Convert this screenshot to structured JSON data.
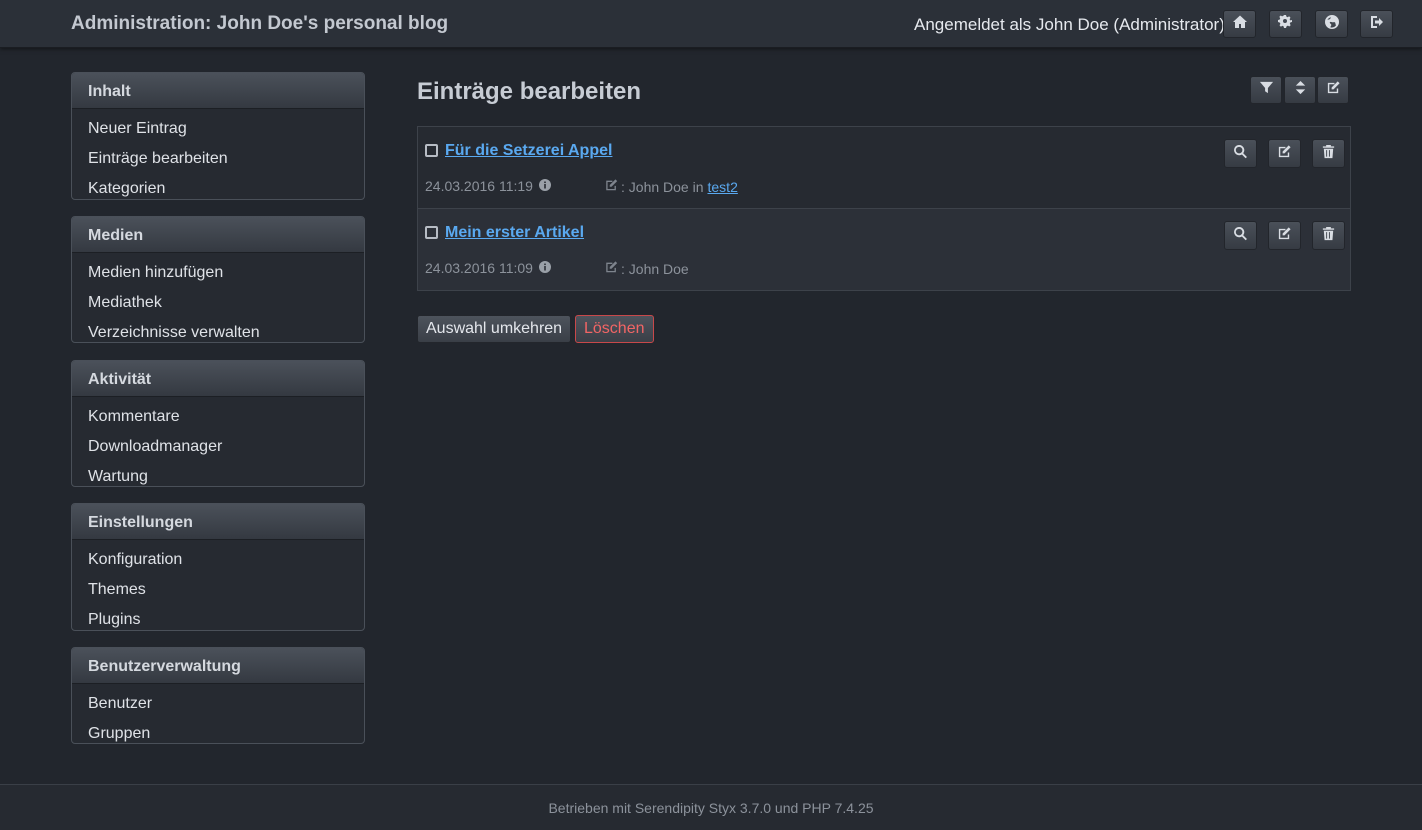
{
  "header": {
    "site_title": "Administration: John Doe's personal blog",
    "login_info": "Angemeldet als John Doe (Administrator)",
    "buttons": [
      "home-icon",
      "gears-icon",
      "globe-icon",
      "sign-out-icon"
    ]
  },
  "sidebar": [
    {
      "title": "Inhalt",
      "items": [
        "Neuer Eintrag",
        "Einträge bearbeiten",
        "Kategorien"
      ]
    },
    {
      "title": "Medien",
      "items": [
        "Medien hinzufügen",
        "Mediathek",
        "Verzeichnisse verwalten"
      ]
    },
    {
      "title": "Aktivität",
      "items": [
        "Kommentare",
        "Downloadmanager",
        "Wartung"
      ]
    },
    {
      "title": "Einstellungen",
      "items": [
        "Konfiguration",
        "Themes",
        "Plugins"
      ]
    },
    {
      "title": "Benutzerverwaltung",
      "items": [
        "Benutzer",
        "Gruppen"
      ]
    }
  ],
  "main": {
    "title": "Einträge bearbeiten",
    "tools": [
      "filter-icon",
      "sort-icon",
      "edit-icon"
    ],
    "entries": [
      {
        "title": "Für die Setzerei Appel",
        "date": "24.03.2016 11:19",
        "author_label": ": John Doe in",
        "category": "test2",
        "checked": false
      },
      {
        "title": "Mein erster Artikel",
        "date": "24.03.2016 11:09",
        "author_label": ": John Doe",
        "category": "",
        "checked": false
      }
    ],
    "invert_button": "Auswahl umkehren",
    "delete_button": "Löschen"
  },
  "footer": {
    "text": "Betrieben mit Serendipity Styx 3.7.0 und PHP 7.4.25"
  },
  "colors": {
    "background": "#22262d",
    "link": "#5aa9f0",
    "danger": "#f26565"
  }
}
